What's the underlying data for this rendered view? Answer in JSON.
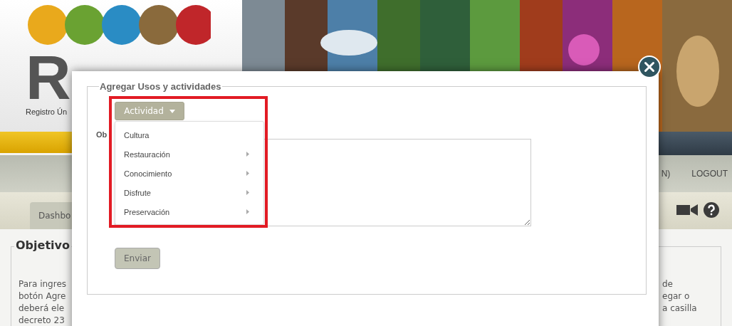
{
  "header": {
    "logo_text": "R",
    "subtitle": "Registro Ún"
  },
  "nav": {
    "items": [
      "N)",
      "LOGOUT"
    ]
  },
  "tabs": [
    {
      "label": "Dashbo"
    }
  ],
  "content": {
    "title": "Objetivo",
    "left_lines": [
      "Para ingres",
      "botón Agre",
      "deberá ele",
      "decreto 23"
    ],
    "right_lines": [
      "de",
      "egar o",
      "a casilla"
    ]
  },
  "modal": {
    "title": "Agregar Usos y actividades",
    "dropdown": {
      "label": "Actividad",
      "expanded": true,
      "items": [
        {
          "label": "Cultura",
          "has_submenu": false
        },
        {
          "label": "Restauración",
          "has_submenu": true
        },
        {
          "label": "Conocimiento",
          "has_submenu": true
        },
        {
          "label": "Disfrute",
          "has_submenu": true
        },
        {
          "label": "Preservación",
          "has_submenu": true
        }
      ]
    },
    "field_label": "Ob",
    "submit": "Enviar"
  }
}
